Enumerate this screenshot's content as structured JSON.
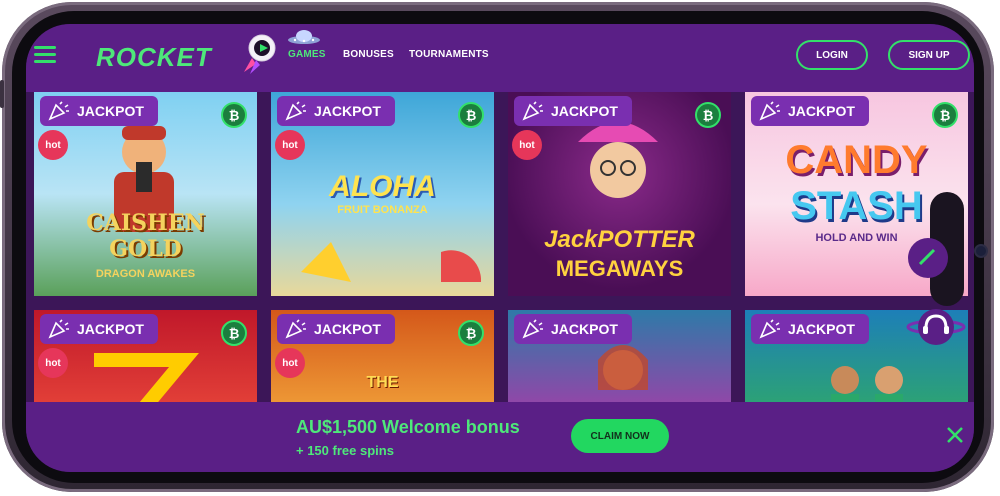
{
  "header": {
    "logo_text": "ROCKET",
    "nav": [
      {
        "label": "GAMES",
        "active": true
      },
      {
        "label": "BONUSES",
        "active": false
      },
      {
        "label": "TOURNAMENTS",
        "active": false
      }
    ],
    "login_label": "LOGIN",
    "signup_label": "SIGN UP"
  },
  "badge": {
    "jackpot_label": "JACKPOT",
    "hot_label": "hot",
    "currency_symbol": "₿"
  },
  "games": [
    {
      "title_line1": "CAISHEN",
      "title_line2": "GOLD",
      "title_line3": "DRAGON AWAKES",
      "hot": true
    },
    {
      "title_line1": "ALOHA",
      "title_line2": "FRUIT BONANZA",
      "title_line3": "",
      "hot": true
    },
    {
      "title_line1": "JackPOTTER",
      "title_line2": "MEGAWAYS",
      "title_line3": "",
      "hot": true
    },
    {
      "title_line1": "CANDY",
      "title_line2": "STASH",
      "title_line3": "HOLD AND WIN",
      "hot": false
    },
    {
      "title_line1": "",
      "title_line2": "",
      "title_line3": "",
      "hot": true
    },
    {
      "title_line1": "THE",
      "title_line2": "",
      "title_line3": "",
      "hot": true
    },
    {
      "title_line1": "",
      "title_line2": "",
      "title_line3": "",
      "hot": false
    },
    {
      "title_line1": "",
      "title_line2": "",
      "title_line3": "",
      "hot": false
    }
  ],
  "footer": {
    "bonus_title": "AU$1,500 Welcome bonus",
    "bonus_sub": "+ 150 free spins",
    "claim_label": "CLAIM NOW"
  },
  "colors": {
    "accent": "#33e06a",
    "header_bg": "#5a1f86",
    "jackpot_bg": "#7a2fb0",
    "hot_bg": "#e6365a"
  }
}
